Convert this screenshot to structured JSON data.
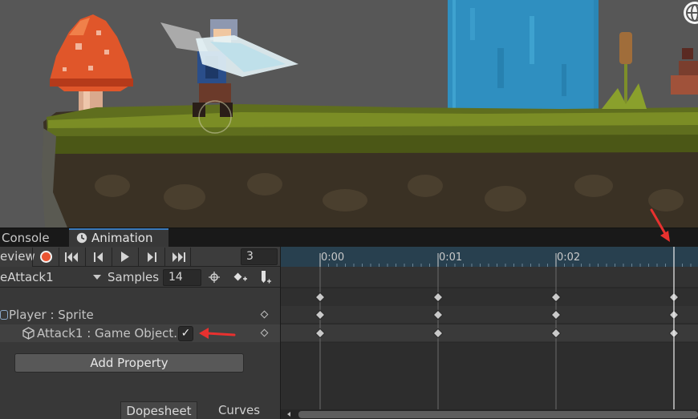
{
  "tabs": {
    "console_label": "Console",
    "animation_label": "Animation"
  },
  "toolbar": {
    "preview_label": "eview",
    "current_frame": "3"
  },
  "clip": {
    "name": "eAttack1",
    "samples_label": "Samples",
    "samples_value": "14"
  },
  "properties": {
    "player_row": "Player : Sprite",
    "attack_row": "Attack1 : Game Object.I",
    "attack_checked": "✓"
  },
  "buttons": {
    "add_property": "Add Property"
  },
  "bottom_tabs": {
    "dopesheet": "Dopesheet",
    "curves": "Curves"
  },
  "timeline": {
    "ruler_labels": [
      "0:00",
      "0:01",
      "0:02"
    ],
    "keyframe_times": [
      "0:00",
      "0:01",
      "0:02",
      "0:03"
    ],
    "playhead_time": "0:03"
  },
  "colors": {
    "record": "#ea5432",
    "timeline_ruler": "#28404f",
    "annotation": "#e8312f"
  }
}
